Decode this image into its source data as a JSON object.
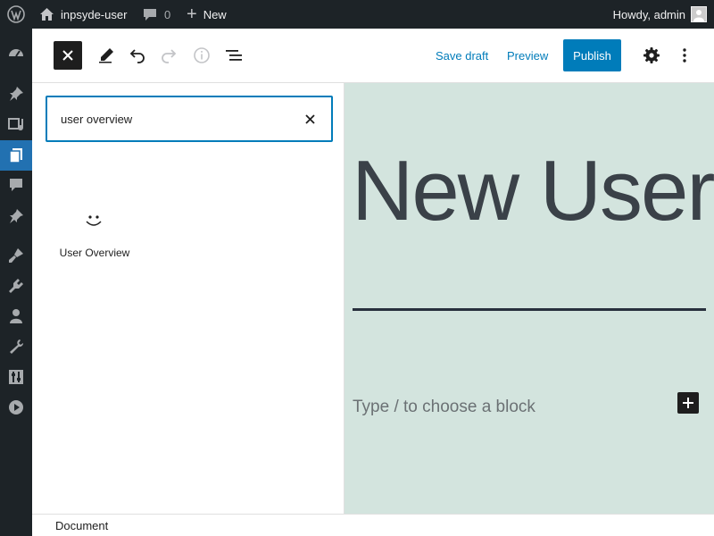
{
  "admin_bar": {
    "site_name": "inpsyde-user",
    "comments_count": "0",
    "new_label": "New",
    "greeting": "Howdy, admin"
  },
  "admin_menu": {
    "icons": [
      "dashboard-icon",
      "posts-icon",
      "media-icon",
      "pages-icon",
      "comments-icon",
      "pin-icon",
      "appearance-icon",
      "plugins-icon",
      "users-icon",
      "tools-icon",
      "settings-icon",
      "play-icon"
    ],
    "active_icon": "pages-icon",
    "active_color": "#2271b1"
  },
  "toolbar": {
    "save_draft_label": "Save draft",
    "preview_label": "Preview",
    "publish_label": "Publish",
    "accent_color": "#007cba"
  },
  "inserter": {
    "search_value": "user overview",
    "results": [
      {
        "label": "User Overview",
        "icon": "smiley-icon"
      }
    ]
  },
  "canvas": {
    "title": "New User",
    "placeholder": "Type / to choose a block",
    "background": "#d3e4de"
  },
  "footer": {
    "breadcrumb": "Document"
  }
}
